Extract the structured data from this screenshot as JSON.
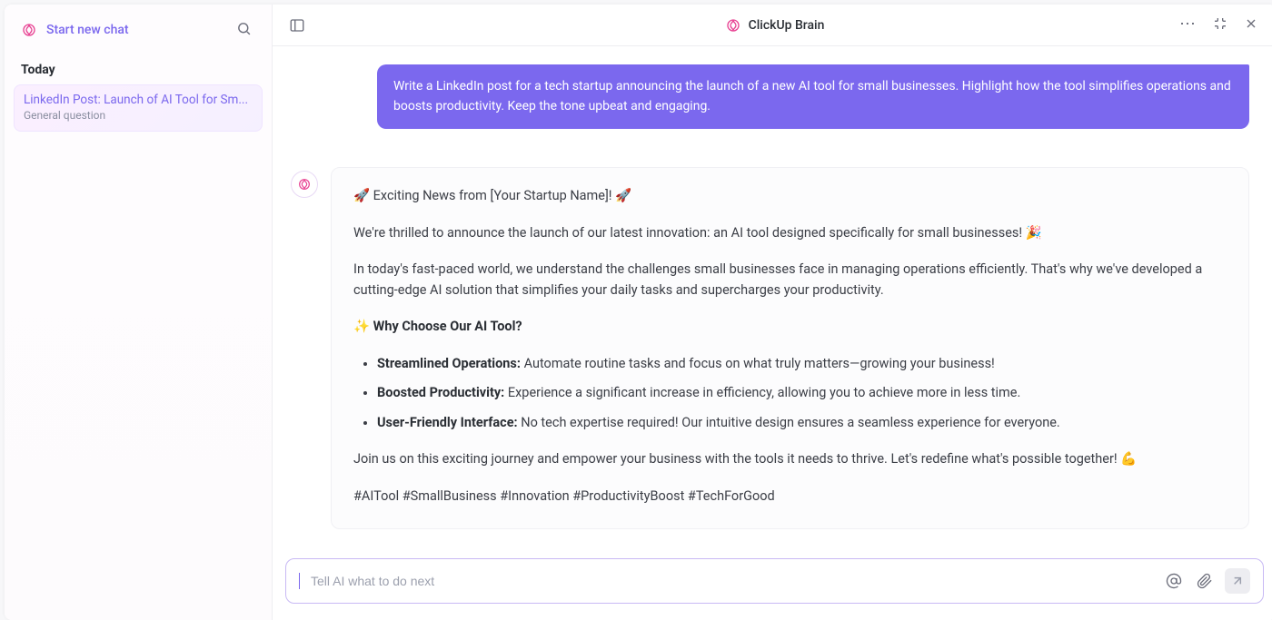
{
  "sidebar": {
    "newchat_label": "Start new chat",
    "section_today": "Today",
    "chat_item": {
      "title": "LinkedIn Post: Launch of AI Tool for Sm...",
      "subtitle": "General question"
    }
  },
  "header": {
    "title": "ClickUp Brain"
  },
  "conversation": {
    "user_message": "Write a LinkedIn post for a tech startup announcing the launch of a new AI tool for small businesses. Highlight how the tool simplifies operations and boosts productivity. Keep the tone upbeat and engaging.",
    "ai_message": {
      "line_headline": "🚀 Exciting News from [Your Startup Name]! 🚀",
      "line_announce": "We're thrilled to announce the launch of our latest innovation: an AI tool designed specifically for small businesses! 🎉",
      "line_context": "In today's fast-paced world, we understand the challenges small businesses face in managing operations efficiently. That's why we've developed a cutting-edge AI solution that simplifies your daily tasks and supercharges your productivity.",
      "why_heading_prefix": "✨ ",
      "why_heading": "Why Choose Our AI Tool?",
      "bullets": [
        {
          "label": "Streamlined Operations:",
          "text": " Automate routine tasks and focus on what truly matters—growing your business!"
        },
        {
          "label": "Boosted Productivity:",
          "text": " Experience a significant increase in efficiency, allowing you to achieve more in less time."
        },
        {
          "label": "User-Friendly Interface:",
          "text": " No tech expertise required! Our intuitive design ensures a seamless experience for everyone."
        }
      ],
      "line_cta": "Join us on this exciting journey and empower your business with the tools it needs to thrive. Let's redefine what's possible together! 💪",
      "line_hashtags": "#AITool #SmallBusiness #Innovation #ProductivityBoost #TechForGood"
    }
  },
  "input": {
    "placeholder": "Tell AI what to do next"
  }
}
